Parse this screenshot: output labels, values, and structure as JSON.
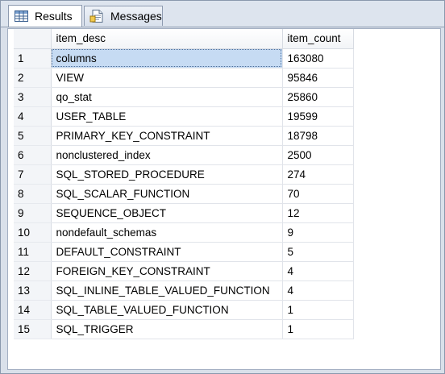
{
  "tabs": [
    {
      "label": "Results",
      "icon": "grid-icon",
      "active": true
    },
    {
      "label": "Messages",
      "icon": "document-icon",
      "active": false
    }
  ],
  "grid": {
    "columns": [
      "item_desc",
      "item_count"
    ],
    "rows": [
      {
        "num": "1",
        "item_desc": "columns",
        "item_count": "163080"
      },
      {
        "num": "2",
        "item_desc": "VIEW",
        "item_count": "95846"
      },
      {
        "num": "3",
        "item_desc": "qo_stat",
        "item_count": "25860"
      },
      {
        "num": "4",
        "item_desc": "USER_TABLE",
        "item_count": "19599"
      },
      {
        "num": "5",
        "item_desc": "PRIMARY_KEY_CONSTRAINT",
        "item_count": "18798"
      },
      {
        "num": "6",
        "item_desc": "nonclustered_index",
        "item_count": "2500"
      },
      {
        "num": "7",
        "item_desc": "SQL_STORED_PROCEDURE",
        "item_count": "274"
      },
      {
        "num": "8",
        "item_desc": "SQL_SCALAR_FUNCTION",
        "item_count": "70"
      },
      {
        "num": "9",
        "item_desc": "SEQUENCE_OBJECT",
        "item_count": "12"
      },
      {
        "num": "10",
        "item_desc": "nondefault_schemas",
        "item_count": "9"
      },
      {
        "num": "11",
        "item_desc": "DEFAULT_CONSTRAINT",
        "item_count": "5"
      },
      {
        "num": "12",
        "item_desc": "FOREIGN_KEY_CONSTRAINT",
        "item_count": "4"
      },
      {
        "num": "13",
        "item_desc": "SQL_INLINE_TABLE_VALUED_FUNCTION",
        "item_count": "4"
      },
      {
        "num": "14",
        "item_desc": "SQL_TABLE_VALUED_FUNCTION",
        "item_count": "1"
      },
      {
        "num": "15",
        "item_desc": "SQL_TRIGGER",
        "item_count": "1"
      }
    ]
  },
  "colors": {
    "selection": "#c6dbf3",
    "background": "#d9e0ea"
  }
}
